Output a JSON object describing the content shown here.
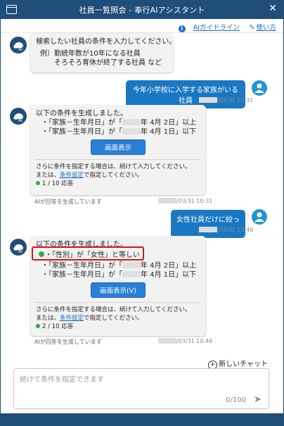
{
  "window": {
    "title": "社員一覧照会 - 奉行AIアシスタント",
    "close_glyph": "✕"
  },
  "toplinks": {
    "guideline": "AIガイドライン",
    "howto": "使い方"
  },
  "msg1": {
    "line1": "検索したい社員の条件を入力してください。",
    "line2": "例）勤続年数が10年になる社員",
    "line3": "　　そろそろ育休が終了する社員 など"
  },
  "user1": {
    "text": "今年小学校に入学する家族がいる社員",
    "time": "/03/31 10:31"
  },
  "resp1": {
    "intro": "以下の条件を生成しました。",
    "cond1_prefix": "・「家族－生年月日」が「",
    "cond1_suffix": "年 4月 2日」以上",
    "cond2_prefix": "・「家族－生年月日」が「",
    "cond2_suffix": "年 4月 1日」以下",
    "button": "画面表示",
    "note1": "さらに条件を指定する場合は、続けて入力してください。",
    "note2_prefix": "または、",
    "note2_link": "条件設定",
    "note2_suffix": "で指定してください。",
    "count": "1 / 10 応答",
    "gen": "AIが回答を生成しています",
    "time": "/03/31 10:31"
  },
  "user2": {
    "text": "女性社員だけに絞って",
    "time": "/03/31 10:46"
  },
  "resp2": {
    "intro": "以下の条件を生成しました。",
    "cond0": "・「性別」が「女性」と等しい",
    "cond1_prefix": "・「家族－生年月日」が「",
    "cond1_suffix": "年 4月 2日」以上",
    "cond2_prefix": "・「家族－生年月日」が「",
    "cond2_suffix": "年 4月 1日」以下",
    "button": "画面表示(V)",
    "note1": "さらに条件を指定する場合は、続けて入力してください。",
    "note2_prefix": "または、",
    "note2_link": "条件設定",
    "note2_suffix": "で指定してください。",
    "count": "2 / 10 応答",
    "gen": "AIが回答を生成しています",
    "time": "/03/31 10:46"
  },
  "newchat": "新しいチャット",
  "input": {
    "placeholder": "続けて条件を指定できます",
    "counter": "0/100"
  },
  "colors": {
    "titlebar": "#1f4e79",
    "user_bubble": "#1a78c2",
    "button": "#2a7fd4",
    "highlight": "#d8141b",
    "status_dot": "#3aa641"
  }
}
